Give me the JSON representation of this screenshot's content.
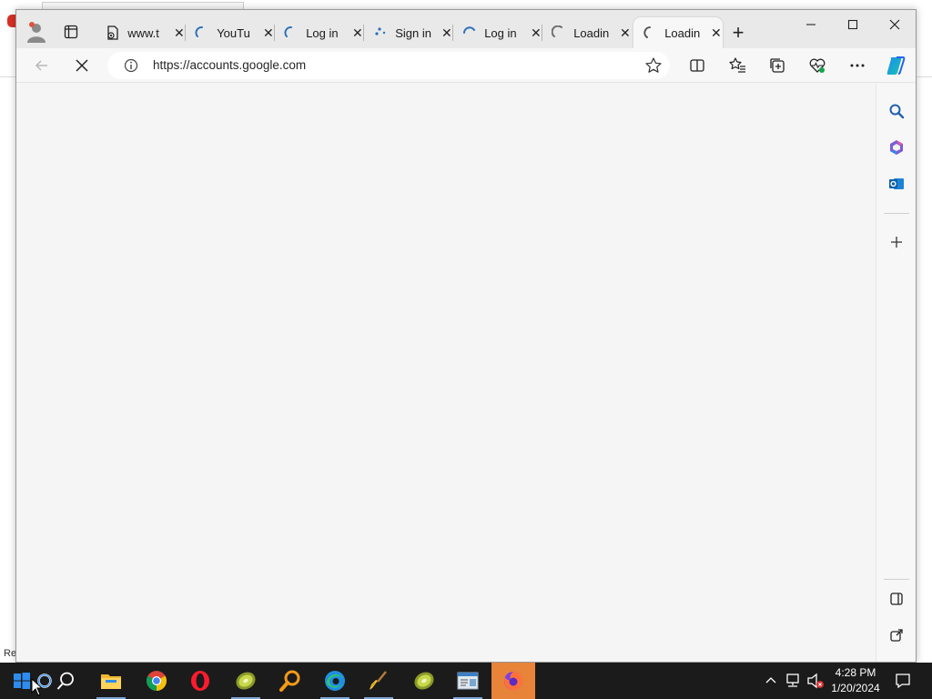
{
  "browser": {
    "tabs": [
      {
        "title": "www.t",
        "icon": "document-icon",
        "active": false
      },
      {
        "title": "YouTu",
        "icon": "loading-spinner-icon",
        "active": false
      },
      {
        "title": "Log in",
        "icon": "loading-spinner-icon",
        "active": false
      },
      {
        "title": "Sign in",
        "icon": "loading-spinner-icon",
        "active": false
      },
      {
        "title": "Log in",
        "icon": "loading-spinner-icon",
        "active": false
      },
      {
        "title": "Loadin",
        "icon": "loading-spinner-icon",
        "active": false
      },
      {
        "title": "Loadin",
        "icon": "loading-spinner-icon",
        "active": true
      }
    ],
    "address": {
      "url": "https://accounts.google.com"
    },
    "colors": {
      "accent": "#0078d4",
      "spinner": "#2b6fb8"
    }
  },
  "desktop": {
    "status_fragment": "Re"
  },
  "taskbar": {
    "items": [
      "windows-start-icon",
      "cortana-icon",
      "search-icon",
      "file-explorer-icon",
      "chrome-icon",
      "opera-icon",
      "kiwi-icon",
      "search-app-icon",
      "edge-icon",
      "ccleaner-icon",
      "kiwi-icon",
      "notepad-icon",
      "firefox-icon"
    ],
    "clock": {
      "time": "4:28 PM",
      "date": "1/20/2024"
    }
  }
}
